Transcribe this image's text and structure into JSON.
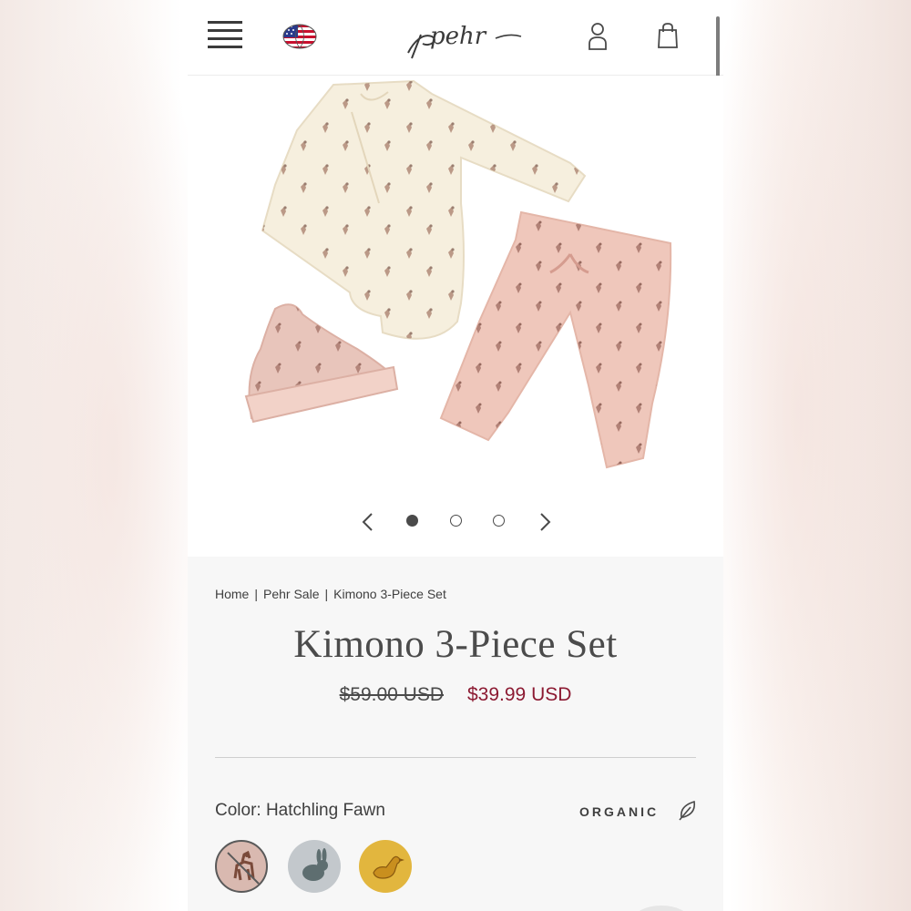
{
  "header": {
    "logo_text": "pehr",
    "menu_icon": "hamburger-menu-icon",
    "region_icon": "us-flag-globe-icon",
    "account_icon": "user-icon",
    "cart_icon": "shopping-bag-icon"
  },
  "carousel": {
    "slides": 3,
    "active_index": 0,
    "prev_icon": "chevron-left-icon",
    "next_icon": "chevron-right-icon"
  },
  "breadcrumb": {
    "items": [
      "Home",
      "Pehr Sale",
      "Kimono 3-Piece Set"
    ],
    "separator": "|"
  },
  "product": {
    "title": "Kimono 3-Piece Set",
    "original_price": "$59.00 USD",
    "sale_price": "$39.99 USD",
    "color_label": "Color: Hatchling Fawn",
    "badge": "ORGANIC",
    "badge_icon": "leaf-icon",
    "swatches": [
      {
        "name": "fawn-swatch",
        "icon": "fawn-icon",
        "color": "#d9b9b0",
        "selected": true
      },
      {
        "name": "bunny-swatch",
        "icon": "bunny-icon",
        "color": "#c3c8cc",
        "selected": false
      },
      {
        "name": "duck-swatch",
        "icon": "duck-icon",
        "color": "#e2b63e",
        "selected": false
      }
    ]
  },
  "colors": {
    "sale_price": "#8c1a32",
    "text": "#3f3f3f",
    "panel_bg": "#f7f7f7"
  }
}
